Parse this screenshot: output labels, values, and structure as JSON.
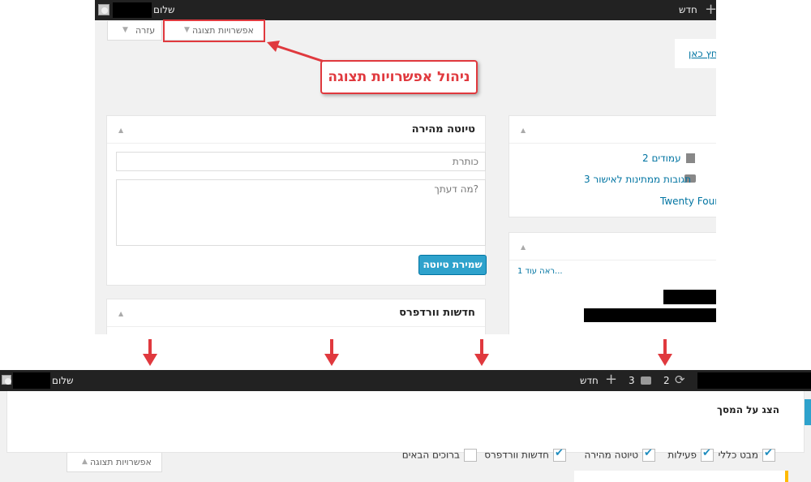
{
  "top": {
    "adminbar": {
      "new_label": "חדש",
      "greeting": "שלום"
    },
    "tabs": {
      "screen_options": "אפשרויות תצוגה",
      "help": "עזרה"
    },
    "callout": "ניהול אפשרויות תצוגה",
    "notice_link": "לחץ כאן.",
    "quick_draft": {
      "title": "טיוטה מהירה",
      "title_placeholder": "כותרת",
      "content_placeholder": "מה דעתך?",
      "save_button": "שמירת טיוטה"
    },
    "wordpress_news": {
      "title": "חדשות וורדפרס"
    },
    "at_a_glance": {
      "pages": "2 עמודים",
      "comments": "3 תגובות ממתינות לאישור",
      "theme": "Twenty Four"
    },
    "activity": {
      "see_more": "ראה עוד 1..."
    }
  },
  "bottom": {
    "adminbar": {
      "greeting": "שלום",
      "new_label": "חדש",
      "comments_count": "3",
      "updates_count": "2"
    },
    "screen_options": {
      "heading": "הצג על המסך",
      "items": [
        {
          "label": "מבט כללי",
          "checked": true
        },
        {
          "label": "פעילות",
          "checked": true
        },
        {
          "label": "טיוטה מהירה",
          "checked": true
        },
        {
          "label": "חדשות וורדפרס",
          "checked": true
        },
        {
          "label": "ברוכים הבאים",
          "checked": false
        }
      ],
      "tab_label": "אפשרויות תצוגה"
    }
  },
  "colors": {
    "accent": "#e0393e",
    "wp_blue": "#2ea2cc",
    "adminbar": "#222222"
  }
}
